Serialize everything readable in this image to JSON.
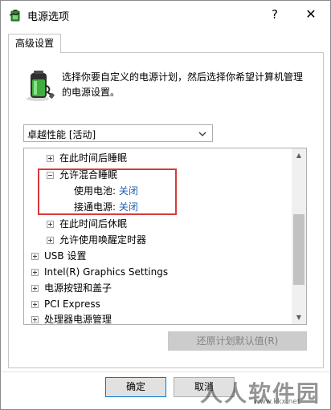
{
  "window": {
    "title": "电源选项",
    "help_label": "?",
    "close_label": "✕"
  },
  "tab": {
    "label": "高级设置"
  },
  "description": "选择你要自定义的电源计划，然后选择你希望计算机管理的电源设置。",
  "plan": {
    "selected": "卓越性能 [活动]"
  },
  "tree": {
    "items": [
      {
        "label": "在此时间后睡眠",
        "expander": "plus"
      },
      {
        "label": "允许混合睡眠",
        "expander": "minus"
      },
      {
        "label": "使用电池:",
        "value": "关闭"
      },
      {
        "label": "接通电源:",
        "value": "关闭"
      },
      {
        "label": "在此时间后休眠",
        "expander": "plus"
      },
      {
        "label": "允许使用唤醒定时器",
        "expander": "plus"
      },
      {
        "label": "USB 设置",
        "expander": "plus"
      },
      {
        "label": "Intel(R) Graphics Settings",
        "expander": "plus"
      },
      {
        "label": "电源按钮和盖子",
        "expander": "plus"
      },
      {
        "label": "PCI Express",
        "expander": "plus"
      },
      {
        "label": "处理器电源管理",
        "expander": "plus"
      }
    ],
    "highlight_color": "#d93a3a",
    "value_color": "#1a5fb4"
  },
  "buttons": {
    "restore": "还原计划默认值(R)",
    "ok": "确定",
    "cancel": "取消"
  },
  "watermark": {
    "text": "人人软件园",
    "url": "www.kkx.net"
  }
}
